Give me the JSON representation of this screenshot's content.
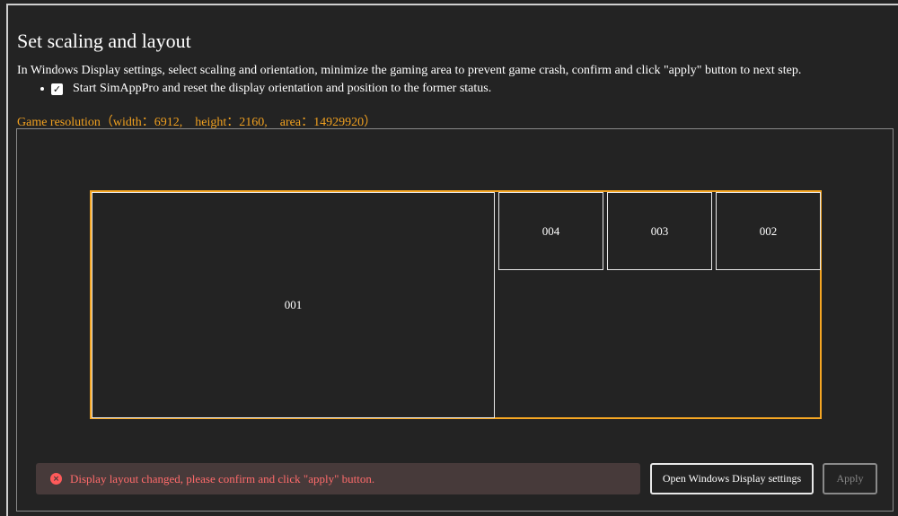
{
  "title": "Set scaling and layout",
  "description": "In Windows Display settings, select scaling and orientation, minimize the gaming area to prevent game crash, confirm and click \"apply\" button to next step.",
  "checkbox": {
    "label": "Start SimAppPro and reset the display orientation and position to the former status.",
    "checked": true,
    "glyph": "✓"
  },
  "resolution": "Game resolution（width：6912,　height：2160,　area：14929920）",
  "monitors": [
    {
      "label": "001"
    },
    {
      "label": "004"
    },
    {
      "label": "003"
    },
    {
      "label": "002"
    }
  ],
  "alert": {
    "icon": "error-icon",
    "glyph": "×",
    "text": "Display layout changed, please confirm and click \"apply\" button."
  },
  "buttons": {
    "open": "Open Windows Display settings",
    "apply": "Apply"
  },
  "colors": {
    "accent": "#f5a623",
    "error": "#ff6b6b"
  }
}
